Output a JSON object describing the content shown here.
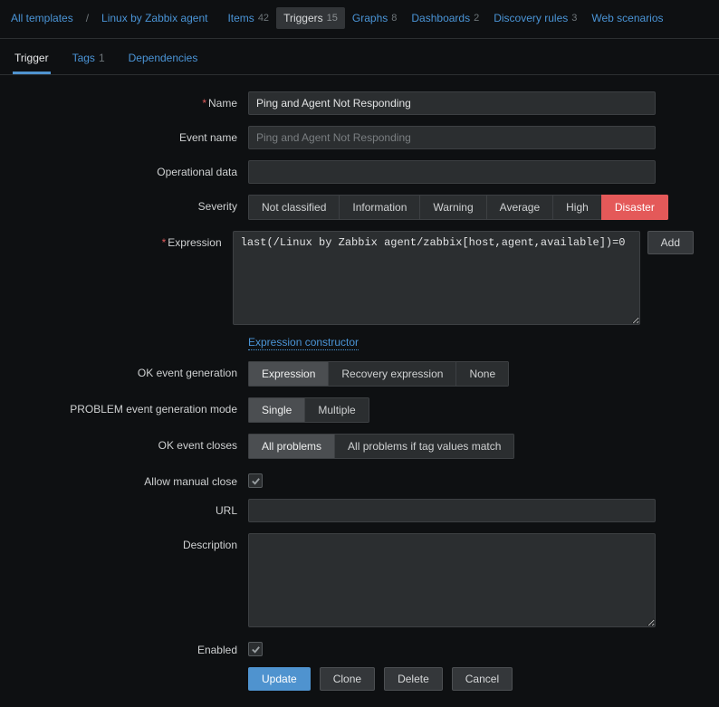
{
  "breadcrumb": {
    "root": "All templates",
    "current": "Linux by Zabbix agent"
  },
  "nav": [
    {
      "label": "Items",
      "count": 42,
      "active": false
    },
    {
      "label": "Triggers",
      "count": 15,
      "active": true
    },
    {
      "label": "Graphs",
      "count": 8,
      "active": false
    },
    {
      "label": "Dashboards",
      "count": 2,
      "active": false
    },
    {
      "label": "Discovery rules",
      "count": 3,
      "active": false
    },
    {
      "label": "Web scenarios",
      "count": "",
      "active": false
    }
  ],
  "tabs": [
    {
      "label": "Trigger",
      "count": "",
      "active": true
    },
    {
      "label": "Tags",
      "count": 1,
      "active": false
    },
    {
      "label": "Dependencies",
      "count": "",
      "active": false
    }
  ],
  "labels": {
    "name": "Name",
    "event_name": "Event name",
    "operational_data": "Operational data",
    "severity": "Severity",
    "expression": "Expression",
    "expr_constructor": "Expression constructor",
    "ok_event_gen": "OK event generation",
    "problem_mode": "PROBLEM event generation mode",
    "ok_event_closes": "OK event closes",
    "allow_manual": "Allow manual close",
    "url": "URL",
    "description": "Description",
    "enabled": "Enabled",
    "add_btn": "Add"
  },
  "fields": {
    "name": "Ping and Agent Not Responding",
    "event_name_placeholder": "Ping and Agent Not Responding",
    "operational_data": "",
    "expression": "last(/Linux by Zabbix agent/zabbix[host,agent,available])=0",
    "url": "",
    "description": ""
  },
  "severity": {
    "options": [
      "Not classified",
      "Information",
      "Warning",
      "Average",
      "High",
      "Disaster"
    ],
    "selected": "Disaster"
  },
  "ok_event_gen": {
    "options": [
      "Expression",
      "Recovery expression",
      "None"
    ],
    "selected": "Expression"
  },
  "problem_mode": {
    "options": [
      "Single",
      "Multiple"
    ],
    "selected": "Single"
  },
  "ok_event_closes": {
    "options": [
      "All problems",
      "All problems if tag values match"
    ],
    "selected": "All problems"
  },
  "allow_manual_close": true,
  "enabled": true,
  "actions": {
    "update": "Update",
    "clone": "Clone",
    "delete": "Delete",
    "cancel": "Cancel"
  }
}
